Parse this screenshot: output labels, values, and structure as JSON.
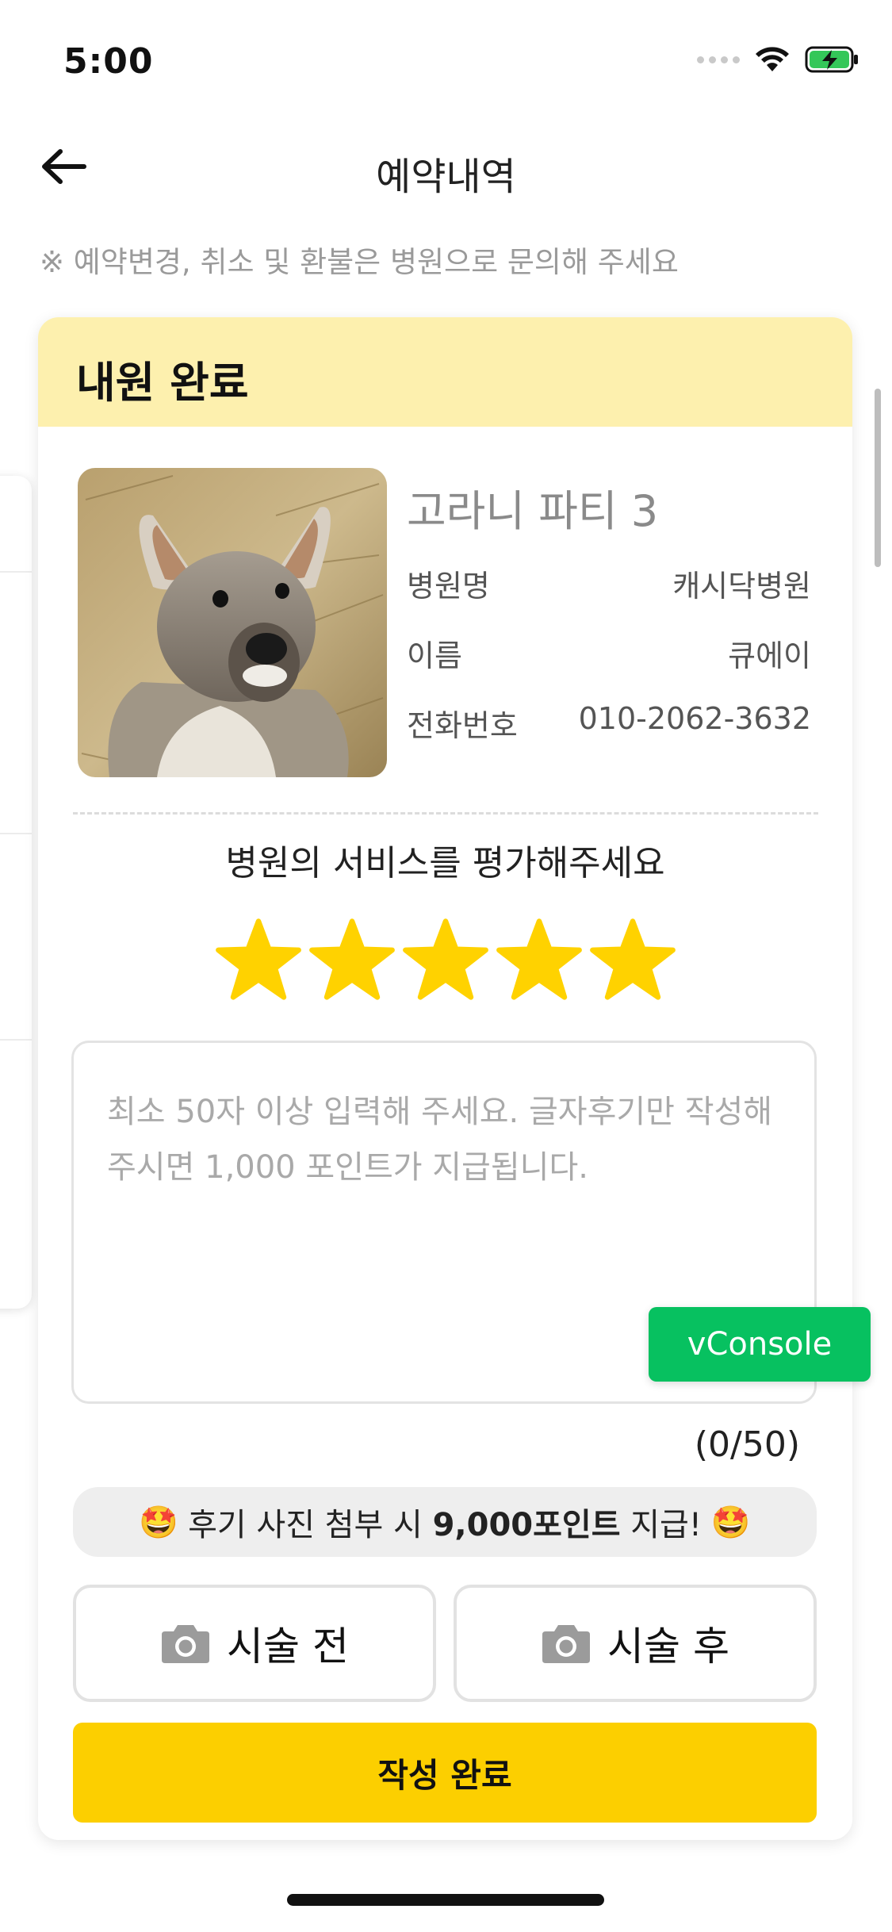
{
  "status_bar": {
    "time": "5:00",
    "icons": [
      "signal-dots-icon",
      "wifi-icon",
      "battery-charging-icon"
    ]
  },
  "header": {
    "title": "예약내역",
    "back_icon": "arrow-left-icon"
  },
  "notice": "※ 예약변경, 취소 및 환불은 병원으로 문의해 주세요",
  "card": {
    "status_label": "내원 완료",
    "product_name": "고라니 파티 3",
    "info": [
      {
        "label": "병원명",
        "value": "캐시닥병원"
      },
      {
        "label": "이름",
        "value": "큐에이"
      },
      {
        "label": "전화번호",
        "value": "010-2062-3632"
      }
    ],
    "rating": {
      "prompt": "병원의 서비스를 평가해주세요",
      "value": 5,
      "max": 5
    },
    "review": {
      "placeholder": "최소 50자 이상 입력해 주세요. 글자후기만 작성해주시면 1,000 포인트가 지급됩니다.",
      "value": "",
      "counter": "(0/50)"
    },
    "promo": {
      "prefix": "후기 사진 첨부 시 ",
      "highlight": "9,000포인트",
      "suffix": " 지급!",
      "emoji": "🤩"
    },
    "photo_buttons": {
      "before": "시술 전",
      "after": "시술 후"
    },
    "submit_label": "작성 완료"
  },
  "vconsole_label": "vConsole",
  "colors": {
    "accent": "#fccf00",
    "header_bg": "#fdf0ae",
    "star": "#ffd200",
    "vconsole": "#07c160"
  }
}
